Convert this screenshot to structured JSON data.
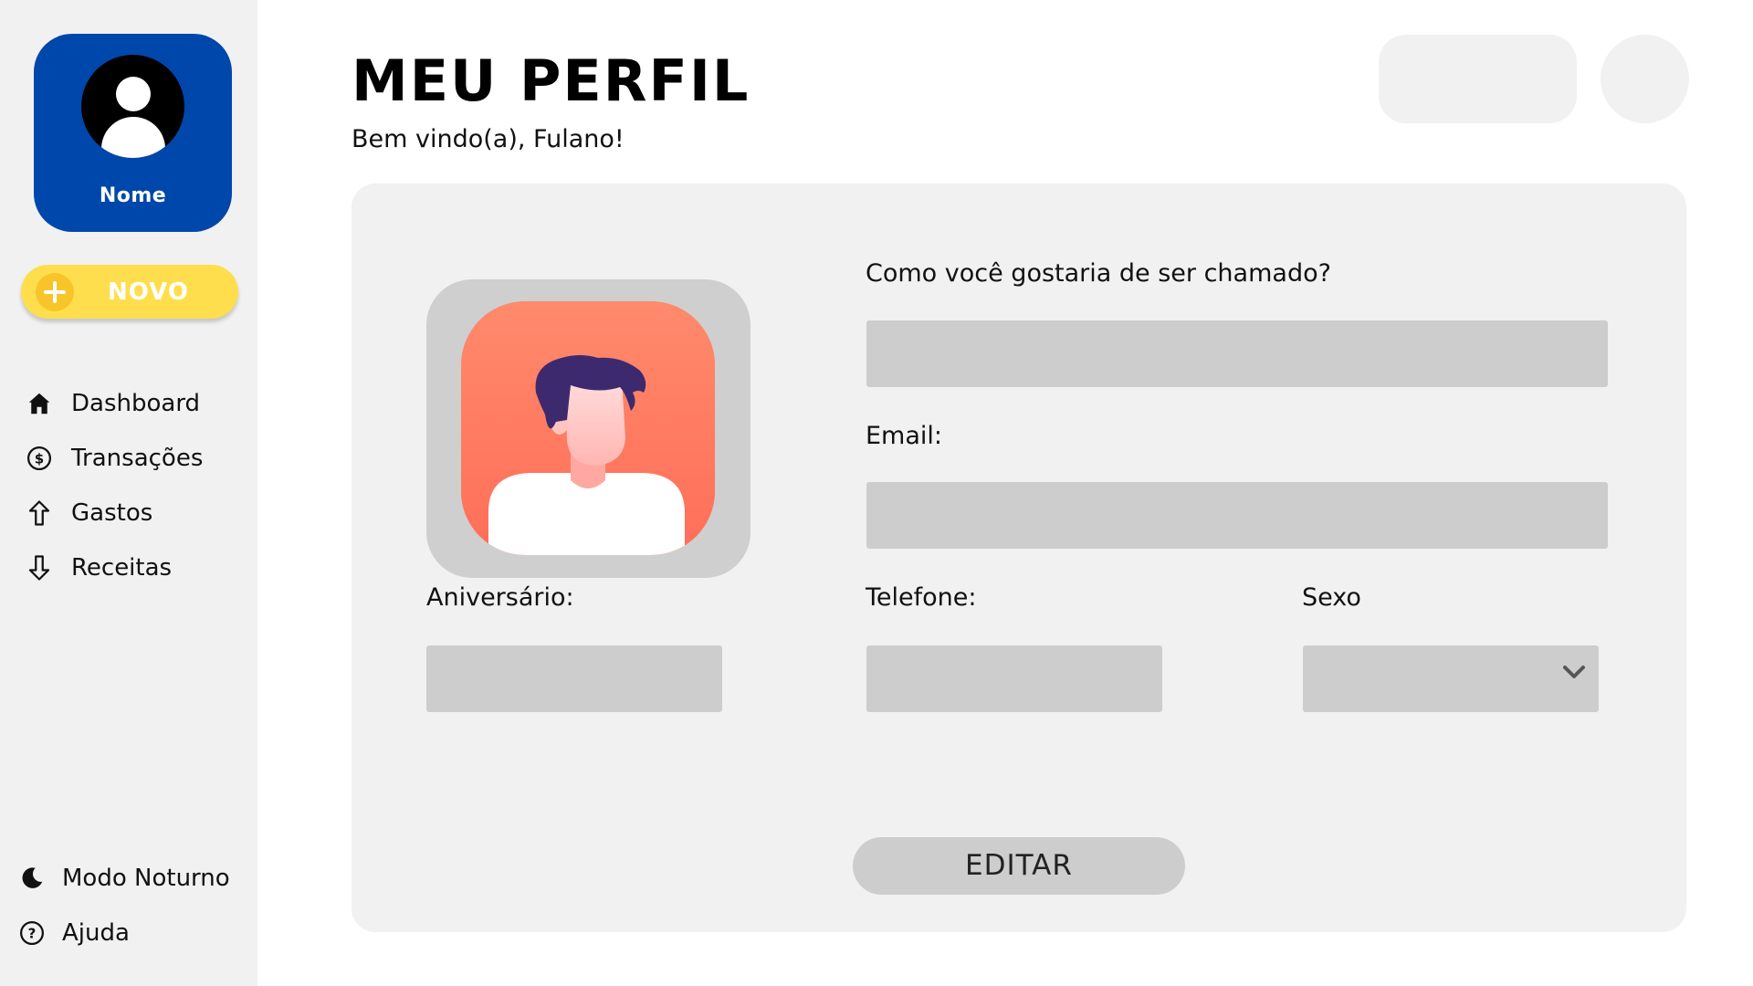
{
  "sidebar": {
    "profile_name": "Nome",
    "new_button_label": "NOVO",
    "nav_items": [
      {
        "label": "Dashboard",
        "icon": "home-icon"
      },
      {
        "label": "Transações",
        "icon": "dollar-circle-icon"
      },
      {
        "label": "Gastos",
        "icon": "arrow-up-icon"
      },
      {
        "label": "Receitas",
        "icon": "arrow-down-icon"
      }
    ],
    "bottom_items": [
      {
        "label": "Modo Noturno",
        "icon": "moon-icon"
      },
      {
        "label": "Ajuda",
        "icon": "help-icon"
      }
    ]
  },
  "header": {
    "title": "MEU PERFIL",
    "subtitle": "Bem vindo(a), Fulano!"
  },
  "form": {
    "nickname_label": "Como você gostaria de ser chamado?",
    "email_label": "Email:",
    "birthday_label": "Aniversário:",
    "phone_label": "Telefone:",
    "gender_label": "Sexo",
    "edit_button_label": "EDITAR"
  },
  "colors": {
    "brand_blue": "#0047ab",
    "new_button_yellow": "#ffde4d",
    "panel_gray": "#f1f1f1",
    "field_gray": "#cdcdcd",
    "avatar_orange": "#ff8068"
  }
}
